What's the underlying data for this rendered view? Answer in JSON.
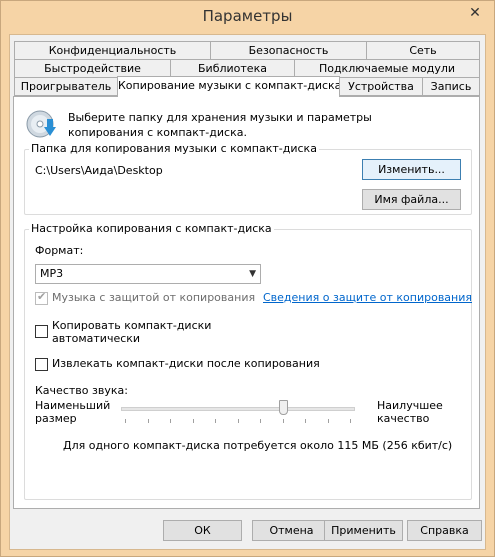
{
  "window": {
    "title": "Параметры",
    "close": "✕"
  },
  "tabs": {
    "row1": [
      "Конфиденциальность",
      "Безопасность",
      "Сеть"
    ],
    "row2": [
      "Быстродействие",
      "Библиотека",
      "Подключаемые модули"
    ],
    "row3": [
      "Проигрыватель",
      "Копирование музыки с компакт-диска",
      "Устройства",
      "Запись"
    ],
    "active": "Копирование музыки с компакт-диска"
  },
  "header": {
    "icon": "cd-rip-icon",
    "description": "Выберите папку для хранения музыки и параметры копирования с компакт-диска."
  },
  "folder_group": {
    "title": "Папка для копирования музыки с компакт-диска",
    "path": "C:\\Users\\Аида\\Desktop",
    "change_button": "Изменить...",
    "filename_button": "Имя файла..."
  },
  "settings_group": {
    "title": "Настройка копирования с компакт-диска",
    "format_label": "Формат:",
    "format_value": "MP3",
    "copy_protect_label": "Музыка с защитой от копирования",
    "copy_protect_checked": true,
    "copy_protect_link": "Сведения о защите от копирования",
    "auto_copy_label_1": "Копировать компакт-диски",
    "auto_copy_label_2": "автоматически",
    "auto_copy_checked": false,
    "eject_label": "Извлекать компакт-диски после копирования",
    "eject_checked": false,
    "quality_label": "Качество звука:",
    "min_label_1": "Наименьший",
    "min_label_2": "размер",
    "max_label_1": "Наилучшее",
    "max_label_2": "качество",
    "quality_level": 0.7,
    "summary": "Для одного компакт-диска потребуется около   115 МБ (256 кбит/с)"
  },
  "footer": {
    "ok": "ОК",
    "cancel": "Отмена",
    "apply": "Применить",
    "help": "Справка"
  },
  "colors": {
    "frame": "#f6d4a6",
    "link": "#0066cc",
    "accent": "#3c7fb1"
  }
}
